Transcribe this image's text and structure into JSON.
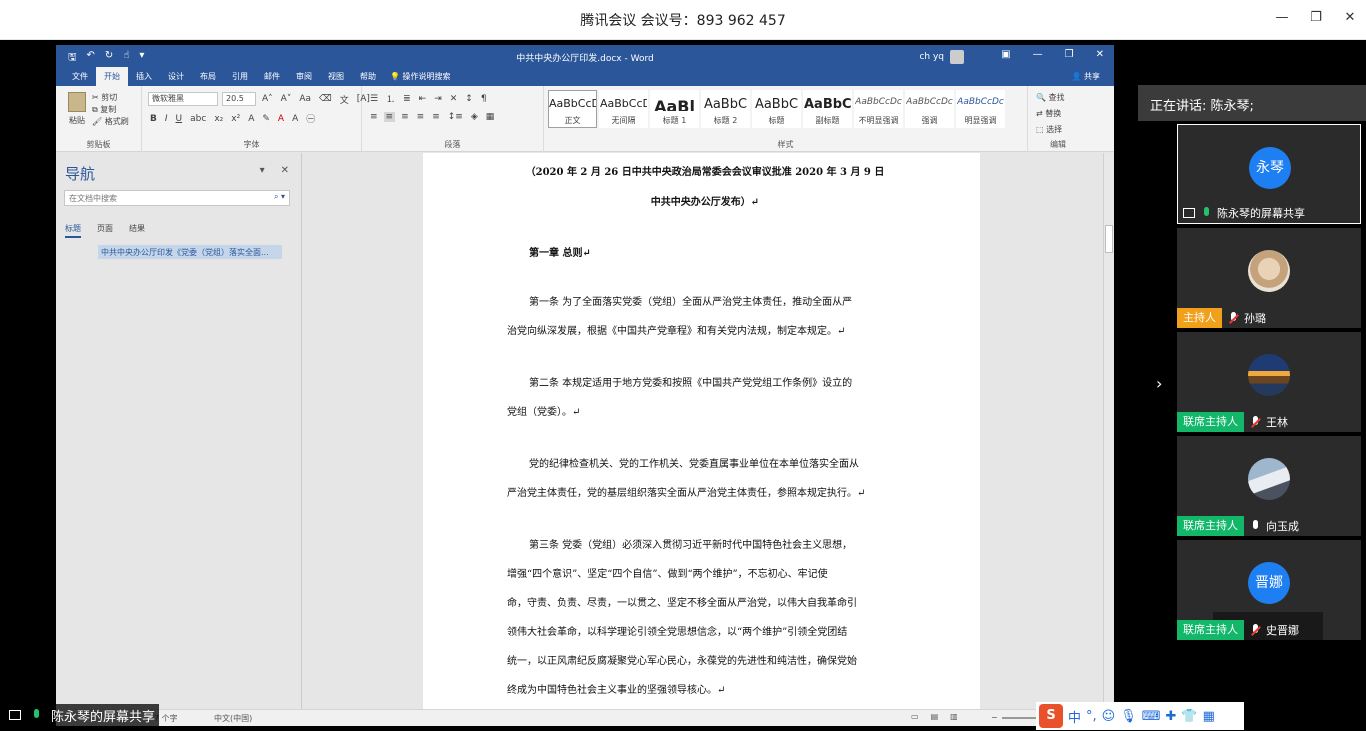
{
  "meeting": {
    "title": "腾讯会议 会议号：893 962 457"
  },
  "word": {
    "doc_title": "中共中央办公厅印发.docx  -  Word",
    "user": "ch yq",
    "tabs": [
      "文件",
      "开始",
      "插入",
      "设计",
      "布局",
      "引用",
      "邮件",
      "审阅",
      "视图",
      "帮助"
    ],
    "active_tab": "开始",
    "tell_me": "操作说明搜索",
    "share": "共享",
    "clipboard": {
      "paste": "粘贴",
      "cut": "剪切",
      "copy": "复制",
      "format_painter": "格式刷",
      "label": "剪贴板"
    },
    "font": {
      "name": "微软雅黑",
      "size": "20.5",
      "label": "字体"
    },
    "paragraph_label": "段落",
    "styles": {
      "label": "样式",
      "items": [
        {
          "preview": "AaBbCcDc",
          "name": "正文"
        },
        {
          "preview": "AaBbCcDc",
          "name": "无间隔"
        },
        {
          "preview": "AaBl",
          "name": "标题 1"
        },
        {
          "preview": "AaBbC",
          "name": "标题 2"
        },
        {
          "preview": "AaBbC",
          "name": "标题"
        },
        {
          "preview": "AaBbC",
          "name": "副标题"
        },
        {
          "preview": "AaBbCcDc",
          "name": "不明显强调"
        },
        {
          "preview": "AaBbCcDc",
          "name": "强调"
        },
        {
          "preview": "AaBbCcDc",
          "name": "明显强调"
        }
      ]
    },
    "editing": {
      "find": "查找",
      "replace": "替换",
      "select": "选择",
      "label": "编辑"
    },
    "nav": {
      "title": "导航",
      "search_placeholder": "在文档中搜索",
      "tabs": [
        "标题",
        "页面",
        "结果"
      ],
      "heading": "中共中央办公厅印发《党委（党组）落实全面..."
    },
    "doc": {
      "line1": "（2020 年 2 月 26 日中共中央政治局常委会会议审议批准 2020 年 3 月 9 日",
      "line2": "中共中央办公厅发布）↵",
      "chapter": "第一章  总则↵",
      "paragraphs": [
        [
          "第一条  为了全面落实党委（党组）全面从严治党主体责任，推动全面从严",
          "治党向纵深发展，根据《中国共产党章程》和有关党内法规，制定本规定。↵"
        ],
        [
          "第二条  本规定适用于地方党委和按照《中国共产党党组工作条例》设立的",
          "党组（党委）。↵"
        ],
        [
          "党的纪律检查机关、党的工作机关、党委直属事业单位在本单位落实全面从",
          "严治党主体责任，党的基层组织落实全面从严治党主体责任，参照本规定执行。↵"
        ],
        [
          "第三条  党委（党组）必须深入贯彻习近平新时代中国特色社会主义思想，",
          "增强“四个意识”、坚定“四个自信”、做到“两个维护”，不忘初心、牢记使",
          "命，守责、负责、尽责，一以贯之、坚定不移全面从严治党，以伟大自我革命引",
          "领伟大社会革命，以科学理论引领全党思想信念，以“两个维护”引领全党团结",
          "统一，以正风肃纪反腐凝聚党心军心民心，永葆党的先进性和纯洁性，确保党始",
          "终成为中国特色社会主义事业的坚强领导核心。↵"
        ]
      ]
    },
    "status": {
      "word_count": "7 个字",
      "language": "中文(中国)"
    }
  },
  "share_label": "陈永琴的屏幕共享",
  "ime": {
    "logo": "S",
    "mode": "中"
  },
  "panel": {
    "speaking": "正在讲话: 陈永琴;",
    "participants": [
      {
        "avatar_text": "永琴",
        "role": "",
        "name": "陈永琴的屏幕共享",
        "mic": "on",
        "screen": true
      },
      {
        "avatar_text": "",
        "role": "主持人",
        "name": "孙璐",
        "mic": "muted"
      },
      {
        "avatar_text": "",
        "role": "联席主持人",
        "name": "王林",
        "mic": "muted"
      },
      {
        "avatar_text": "",
        "role": "联席主持人",
        "name": "向玉成",
        "mic": "on"
      },
      {
        "avatar_text": "晋娜",
        "role": "联席主持人",
        "name": "史晋娜",
        "mic": "muted"
      }
    ]
  },
  "colors": {
    "word_blue": "#2b579a",
    "host": "#f0a01b",
    "cohost": "#12b76a",
    "avatar_blue": "#1d7ff2"
  }
}
